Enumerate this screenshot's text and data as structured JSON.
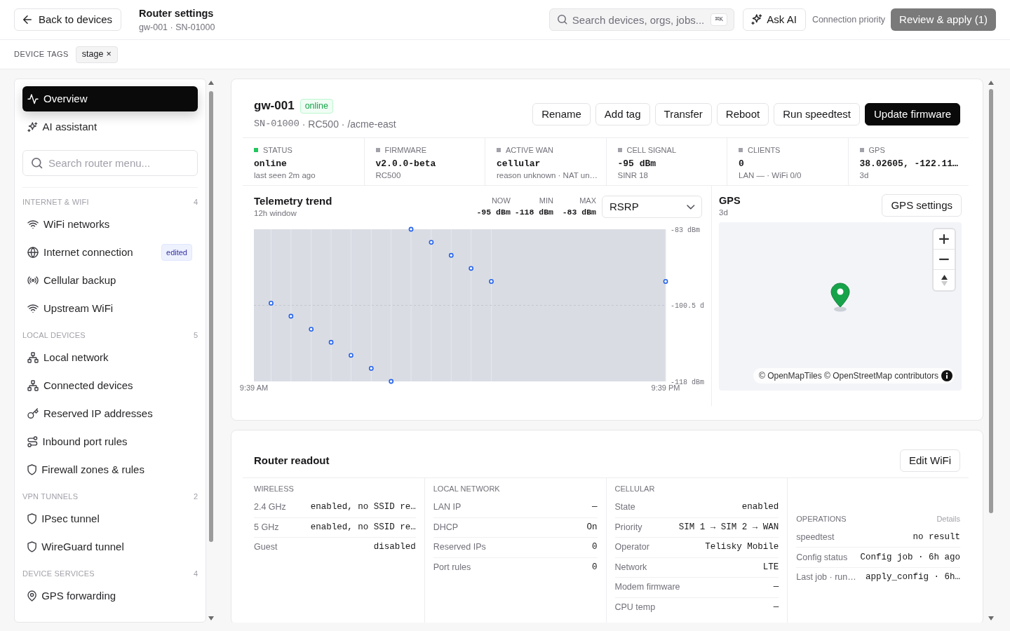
{
  "header": {
    "back_button": "Back to devices",
    "title": "Router settings",
    "subtitle": "gw-001 · SN-01000",
    "search": {
      "placeholder": "Search devices, orgs, jobs...",
      "shortcut": "⌘K"
    },
    "ask_ai_button": "Ask AI",
    "connection_priority_link": "Connection priority",
    "review_button": {
      "label": "Review & apply (1)",
      "disabled": true
    }
  },
  "device_tags": {
    "label": "DEVICE TAGS",
    "tags": [
      {
        "label": "stage",
        "remove": "×"
      }
    ]
  },
  "sidebar": {
    "top_items": [
      {
        "label": "Overview",
        "selected": true
      },
      {
        "label": "AI assistant",
        "selected": false
      }
    ],
    "search": {
      "placeholder": "Search router menu..."
    },
    "sections": [
      {
        "title": "INTERNET & WIFI",
        "count": "4",
        "items": [
          {
            "label": "WiFi networks",
            "selected": false
          },
          {
            "label": "Internet connection",
            "selected": false,
            "badge": "edited"
          },
          {
            "label": "Cellular backup",
            "selected": false
          },
          {
            "label": "Upstream WiFi",
            "selected": false
          }
        ]
      },
      {
        "title": "LOCAL DEVICES",
        "count": "5",
        "items": [
          {
            "label": "Local network",
            "selected": false
          },
          {
            "label": "Connected devices",
            "selected": false
          },
          {
            "label": "Reserved IP addresses",
            "selected": false
          },
          {
            "label": "Inbound port rules",
            "selected": false
          },
          {
            "label": "Firewall zones & rules",
            "selected": false
          }
        ]
      },
      {
        "title": "VPN TUNNELS",
        "count": "2",
        "items": [
          {
            "label": "IPsec tunnel",
            "selected": false
          },
          {
            "label": "WireGuard tunnel",
            "selected": false
          }
        ]
      },
      {
        "title": "DEVICE SERVICES",
        "count": "4",
        "items": [
          {
            "label": "GPS forwarding",
            "selected": false
          }
        ]
      }
    ]
  },
  "device": {
    "name": "gw-001",
    "status": "online",
    "serial": "SN-01000",
    "meta": "· RC500 · /acme-east",
    "actions": [
      {
        "label": "Rename",
        "primary": false
      },
      {
        "label": "Add tag",
        "primary": false
      },
      {
        "label": "Transfer",
        "primary": false
      },
      {
        "label": "Reboot",
        "primary": false
      },
      {
        "label": "Run speedtest",
        "primary": false
      },
      {
        "label": "Update firmware",
        "primary": true
      }
    ],
    "stats": [
      {
        "label": "STATUS",
        "color": "#22c55e",
        "value": "online",
        "detail": "last seen 2m ago"
      },
      {
        "label": "FIRMWARE",
        "color": "#a1a1aa",
        "value": "v2.0.0-beta",
        "detail": "RC500"
      },
      {
        "label": "ACTIVE WAN",
        "color": "#a1a1aa",
        "value": "cellular",
        "detail": "reason unknown · NAT un…"
      },
      {
        "label": "CELL SIGNAL",
        "color": "#a1a1aa",
        "value": "-95 dBm",
        "detail": "SINR 18"
      },
      {
        "label": "CLIENTS",
        "color": "#a1a1aa",
        "value": "0",
        "detail": "LAN — · WiFi 0/0"
      },
      {
        "label": "GPS",
        "color": "#a1a1aa",
        "value": "38.02605, -122.11…",
        "detail": "3d"
      }
    ]
  },
  "telemetry": {
    "title": "Telemetry trend",
    "subtitle": "12h window",
    "stats": [
      {
        "label": "NOW",
        "value": "-95 dBm"
      },
      {
        "label": "MIN",
        "value": "-118 dBm"
      },
      {
        "label": "MAX",
        "value": "-83 dBm"
      }
    ],
    "metric_select": {
      "value": "RSRP"
    },
    "chart_data": {
      "type": "scatter",
      "x": [
        10.15,
        10.73,
        11.32,
        11.9,
        12.48,
        13.07,
        13.65,
        14.23,
        14.82,
        15.4,
        15.98,
        16.57,
        21.65
      ],
      "values": [
        -100,
        -103,
        -106,
        -109,
        -112,
        -115,
        -118,
        -83,
        -86,
        -89,
        -92,
        -95,
        -95
      ],
      "xlim": [
        9.65,
        21.65
      ],
      "ylim": [
        -118,
        -83
      ],
      "xticks": [
        {
          "value": 9.65,
          "label": "9:39 AM"
        },
        {
          "value": 21.65,
          "label": "9:39 PM"
        }
      ],
      "yticks": [
        {
          "value": -83,
          "label": "-83 dBm"
        },
        {
          "value": -100.5,
          "label": "-100.5 d"
        },
        {
          "value": -118,
          "label": "-118 dBm"
        }
      ]
    }
  },
  "gps": {
    "title": "GPS",
    "subtitle": "3d",
    "settings_button": "GPS settings",
    "attribution": "© OpenMapTiles © OpenStreetMap contributors"
  },
  "readout": {
    "title": "Router readout",
    "edit_button": "Edit WiFi",
    "groups": [
      {
        "title": "WIRELESS",
        "rows": [
          {
            "label": "2.4 GHz",
            "value": "enabled, no SSID re…"
          },
          {
            "label": "5 GHz",
            "value": "enabled, no SSID re…"
          },
          {
            "label": "Guest",
            "value": "disabled"
          }
        ]
      },
      {
        "title": "LOCAL NETWORK",
        "rows": [
          {
            "label": "LAN IP",
            "value": "—"
          },
          {
            "label": "DHCP",
            "value": "On"
          },
          {
            "label": "Reserved IPs",
            "value": "0"
          },
          {
            "label": "Port rules",
            "value": "0"
          }
        ]
      },
      {
        "title": "CELLULAR",
        "rows": [
          {
            "label": "State",
            "value": "enabled"
          },
          {
            "label": "Priority",
            "value": "SIM 1 → SIM 2 → WAN"
          },
          {
            "label": "Operator",
            "value": "Telisky Mobile"
          },
          {
            "label": "Network",
            "value": "LTE"
          },
          {
            "label": "Modem firmware",
            "value": "—"
          },
          {
            "label": "CPU temp",
            "value": "—"
          }
        ]
      },
      {
        "title": "OPERATIONS",
        "link": "Details",
        "rows": [
          {
            "label": "speedtest",
            "value": "no result"
          },
          {
            "label": "Config status",
            "value": "Config job · 6h ago"
          },
          {
            "label": "Last job · run…",
            "value": "apply_config · 6h…"
          }
        ]
      }
    ]
  }
}
